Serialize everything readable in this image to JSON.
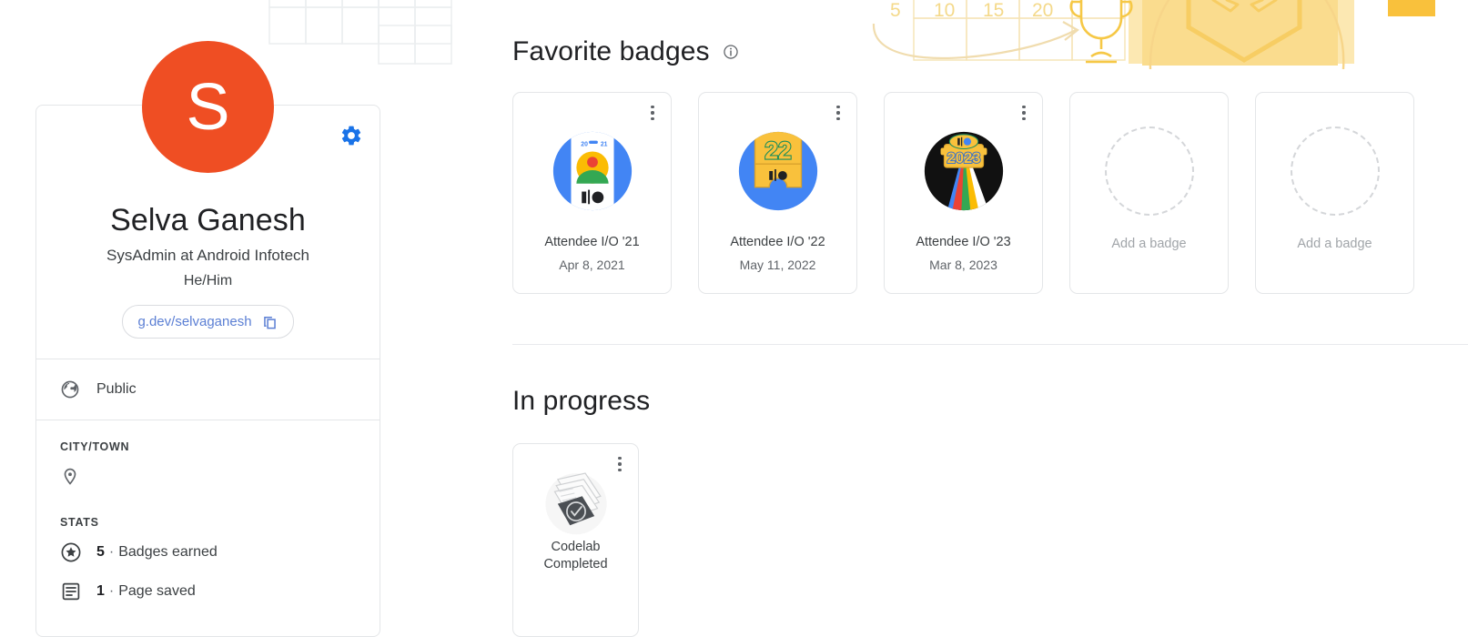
{
  "profile": {
    "avatar_initial": "S",
    "avatar_color": "#EF4E23",
    "name": "Selva Ganesh",
    "role": "SysAdmin at Android Infotech",
    "pronouns": "He/Him",
    "link_text": "g.dev/selvaganesh",
    "visibility": "Public",
    "settings_icon": "gear-icon",
    "copy_icon": "copy-icon",
    "globe_icon": "globe-icon",
    "sections": {
      "city_label": "CITY/TOWN",
      "city_value": "",
      "location_icon": "location-pin-icon",
      "stats_label": "STATS",
      "stats": [
        {
          "icon": "star-badge-icon",
          "count": "5",
          "separator": "·",
          "label": "Badges earned"
        },
        {
          "icon": "page-icon",
          "count": "1",
          "separator": "·",
          "label": "Page saved"
        }
      ]
    }
  },
  "favorite_badges": {
    "title": "Favorite badges",
    "info_icon": "info-icon",
    "menu_icon": "kebab-menu-icon",
    "items": [
      {
        "art": "io-21-badge",
        "name": "Attendee I/O '21",
        "date": "Apr 8, 2021"
      },
      {
        "art": "io-22-badge",
        "name": "Attendee I/O '22",
        "date": "May 11, 2022"
      },
      {
        "art": "io-23-badge",
        "name": "Attendee I/O '23",
        "date": "Mar 8, 2023"
      }
    ],
    "empty_slots": [
      {
        "label": "Add a badge"
      },
      {
        "label": "Add a badge"
      }
    ]
  },
  "in_progress": {
    "title": "In progress",
    "items": [
      {
        "art": "codelab-icon",
        "name_line1": "Codelab",
        "name_line2": "Completed"
      }
    ]
  },
  "banner": {
    "tick_labels": [
      "5",
      "10",
      "15",
      "20"
    ],
    "trophy_icon": "trophy-icon",
    "shield_code_icon": "shield-code-icon",
    "arrow_icon": "curved-arrow-icon",
    "accent_color": "#F9C13C",
    "accent_light": "#FCE8B2"
  }
}
